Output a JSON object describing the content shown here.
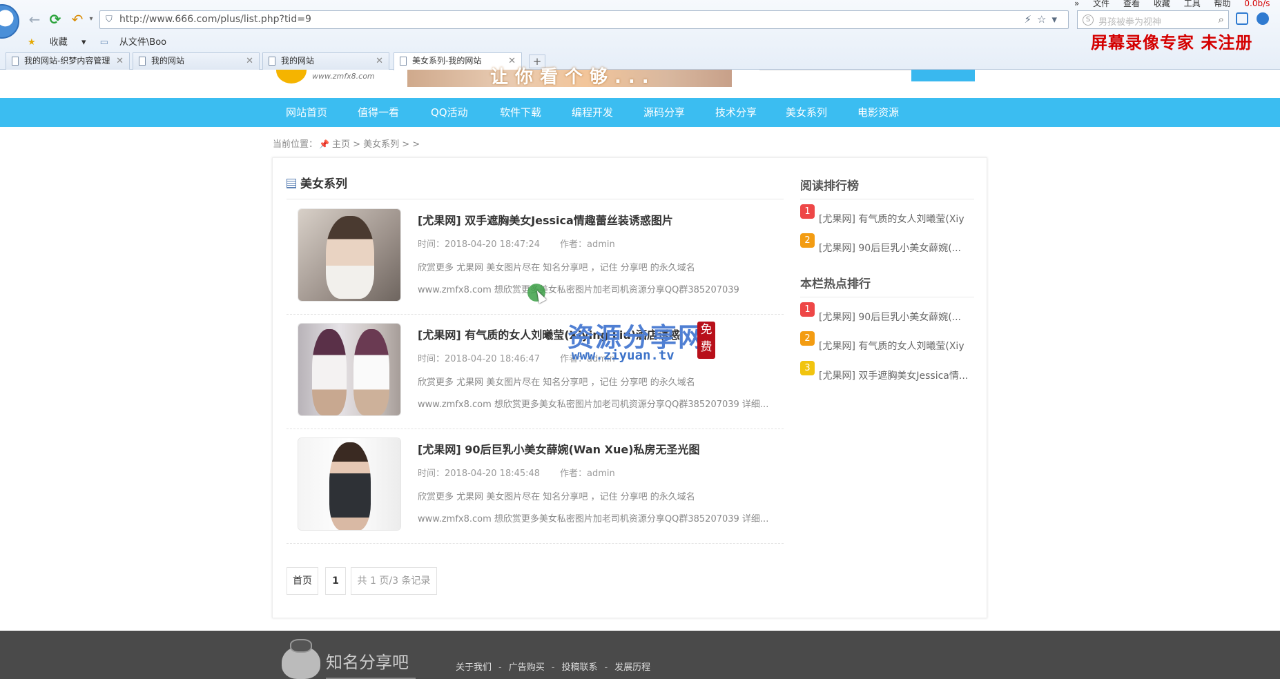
{
  "browser": {
    "url": "http://www.666.com/plus/list.php?tid=9",
    "search_placeholder": "男孩被拳为视神",
    "menu": [
      "文件",
      "查看",
      "收藏",
      "工具",
      "帮助"
    ],
    "menu_extra": "0.0b/s",
    "bookmarks": [
      "收藏",
      "从文件\\Boo"
    ],
    "tabs": [
      {
        "label": "我的网站-织梦内容管理",
        "active": false
      },
      {
        "label": "我的网站",
        "active": false
      },
      {
        "label": "我的网站",
        "active": false
      },
      {
        "label": "美女系列-我的网站",
        "active": true
      }
    ],
    "new_tab": "+",
    "recorder_watermark": "屏幕录像专家  未注册"
  },
  "header": {
    "logo_url_text": "www.zmfx8.com",
    "banner_text": "让你看个够..."
  },
  "nav": {
    "items": [
      "网站首页",
      "值得一看",
      "QQ活动",
      "软件下载",
      "编程开发",
      "源码分享",
      "技术分享",
      "美女系列",
      "电影资源"
    ]
  },
  "breadcrumb": {
    "prefix": "当前位置：",
    "path": "主页 > 美女系列 > >"
  },
  "list": {
    "heading": "美女系列",
    "articles": [
      {
        "title": "[尤果网] 双手遮胸美女Jessica情趣蕾丝装诱惑图片",
        "time": "时间：2018-04-20 18:47:24",
        "author": "作者：admin",
        "desc1": "欣赏更多 尤果网 美女图片尽在 知名分享吧 ，记住 分享吧 的永久域名",
        "desc2": "www.zmfx8.com 想欣赏更多美女私密图片加老司机资源分享QQ群385207039"
      },
      {
        "title": "[尤果网] 有气质的女人刘曦莹(Xiying Liu)酒店诱惑",
        "time": "时间：2018-04-20 18:46:47",
        "author": "作者：admin",
        "desc1": "欣赏更多 尤果网 美女图片尽在 知名分享吧 ，记住 分享吧 的永久域名",
        "desc2": "www.zmfx8.com 想欣赏更多美女私密图片加老司机资源分享QQ群385207039 详细..."
      },
      {
        "title": "[尤果网] 90后巨乳小美女薛婉(Wan Xue)私房无圣光图",
        "time": "时间：2018-04-20 18:45:48",
        "author": "作者：admin",
        "desc1": "欣赏更多 尤果网 美女图片尽在 知名分享吧 ，记住 分享吧 的永久域名",
        "desc2": "www.zmfx8.com 想欣赏更多美女私密图片加老司机资源分享QQ群385207039 详细..."
      }
    ],
    "pagination": {
      "first": "首页",
      "current": "1",
      "summary": "共 1 页/3 条记录"
    }
  },
  "sidebar": {
    "reading_rank": {
      "heading": "阅读排行榜",
      "items": [
        {
          "num": "1",
          "text": "[尤果网] 有气质的女人刘曦莹(Xiy"
        },
        {
          "num": "2",
          "text": "[尤果网] 90后巨乳小美女薛婉(..."
        }
      ]
    },
    "hot_rank": {
      "heading": "本栏热点排行",
      "items": [
        {
          "num": "1",
          "text": "[尤果网] 90后巨乳小美女薛婉(..."
        },
        {
          "num": "2",
          "text": "[尤果网] 有气质的女人刘曦莹(Xiy"
        },
        {
          "num": "3",
          "text": "[尤果网] 双手遮胸美女Jessica情..."
        }
      ]
    },
    "rank_colors": {
      "1": "#ee4747",
      "2": "#f39c12",
      "3": "#f1c40f"
    }
  },
  "overlay_watermark": {
    "main": "资源分享网",
    "url": "www.ziyuan.tv",
    "seal": "免费"
  },
  "footer": {
    "logo_text": "知名分享吧",
    "links": [
      "关于我们",
      "广告购买",
      "投稿联系",
      "发展历程"
    ],
    "separator": "-"
  },
  "colors": {
    "nav_bg": "#3bbdf1",
    "footer_bg": "#4a4a4a",
    "recorder_red": "#d40000"
  }
}
